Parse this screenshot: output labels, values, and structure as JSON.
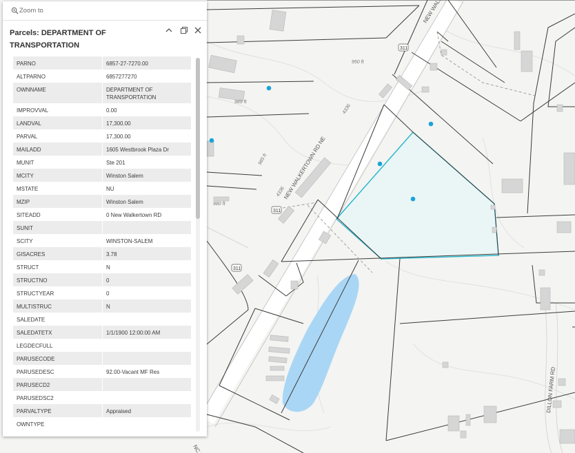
{
  "map": {
    "road_labels": [
      "NEW WALKERTOWN RD NE",
      "NEW WALK",
      "DILLON FARM RD",
      "NC 74"
    ],
    "route_shields": [
      "311",
      "311",
      "311"
    ],
    "contour_labels": [
      "989 ft",
      "980 ft",
      "950 ft",
      "985 ft",
      "4336",
      "4336"
    ],
    "colors": {
      "parcel_line": "#3a3a3a",
      "selected_parcel": "#21b5c8",
      "water": "#a9d6f5",
      "point": "#1aa3d9",
      "building": "#d6d6d6"
    }
  },
  "popup": {
    "zoom_to_label": "Zoom to",
    "zoom_icon": "magnifier-icon",
    "title": "Parcels: DEPARTMENT OF TRANSPORTATION",
    "header_icons": [
      "collapse-icon",
      "dock-icon",
      "close-icon"
    ],
    "rows": [
      {
        "key": "PARNO",
        "value": "6857-27-7270.00"
      },
      {
        "key": "ALTPARNO",
        "value": "6857277270"
      },
      {
        "key": "OWNNAME",
        "value": "DEPARTMENT OF TRANSPORTATION"
      },
      {
        "key": "IMPROVVAL",
        "value": "0.00"
      },
      {
        "key": "LANDVAL",
        "value": "17,300.00"
      },
      {
        "key": "PARVAL",
        "value": "17,300.00"
      },
      {
        "key": "MAILADD",
        "value": "1605 Westbrook Plaza Dr"
      },
      {
        "key": "MUNIT",
        "value": "Ste 201"
      },
      {
        "key": "MCITY",
        "value": "Winston Salem"
      },
      {
        "key": "MSTATE",
        "value": "NU"
      },
      {
        "key": "MZIP",
        "value": "Winston Salem"
      },
      {
        "key": "SITEADD",
        "value": "0 New Walkertown RD"
      },
      {
        "key": "SUNIT",
        "value": ""
      },
      {
        "key": "SCITY",
        "value": "WINSTON-SALEM"
      },
      {
        "key": "GISACRES",
        "value": "3.78"
      },
      {
        "key": "STRUCT",
        "value": "N"
      },
      {
        "key": "STRUCTNO",
        "value": "0"
      },
      {
        "key": "STRUCTYEAR",
        "value": "0"
      },
      {
        "key": "MULTISTRUC",
        "value": "N"
      },
      {
        "key": "SALEDATE",
        "value": ""
      },
      {
        "key": "SALEDATETX",
        "value": "1/1/1900 12:00:00 AM"
      },
      {
        "key": "LEGDECFULL",
        "value": ""
      },
      {
        "key": "PARUSECODE",
        "value": ""
      },
      {
        "key": "PARUSEDESC",
        "value": "92.00-Vacant MF Res"
      },
      {
        "key": "PARUSECD2",
        "value": ""
      },
      {
        "key": "PARUSEDSC2",
        "value": ""
      },
      {
        "key": "PARVALTYPE",
        "value": "Appraised"
      },
      {
        "key": "OWNTYPE",
        "value": ""
      }
    ]
  }
}
